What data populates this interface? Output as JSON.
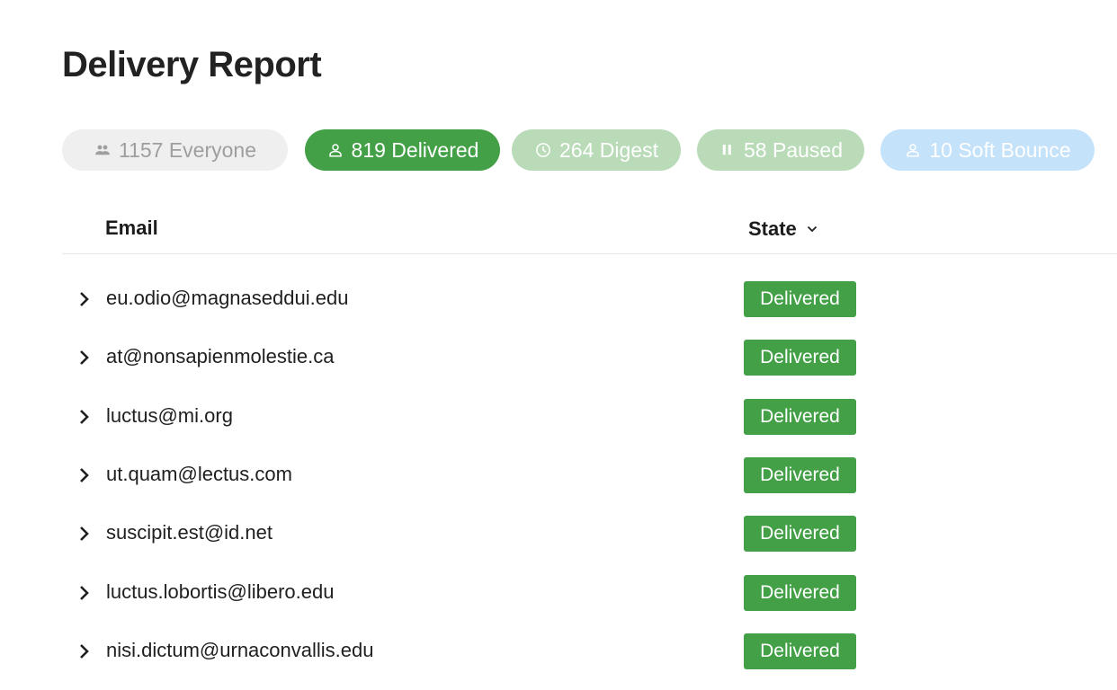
{
  "page": {
    "title": "Delivery Report"
  },
  "filters": [
    {
      "icon": "people-icon",
      "label": "1157 Everyone",
      "count": 1157,
      "name": "Everyone",
      "active": false
    },
    {
      "icon": "person-icon",
      "label": "819 Delivered",
      "count": 819,
      "name": "Delivered",
      "active": true
    },
    {
      "icon": "clock-icon",
      "label": "264 Digest",
      "count": 264,
      "name": "Digest",
      "active": false
    },
    {
      "icon": "pause-icon",
      "label": "58 Paused",
      "count": 58,
      "name": "Paused",
      "active": false
    },
    {
      "icon": "person-icon",
      "label": "10 Soft Bounce",
      "count": 10,
      "name": "Soft Bounce",
      "active": false
    }
  ],
  "table": {
    "columns": {
      "email": "Email",
      "state": "State"
    },
    "rows": [
      {
        "email": "eu.odio@magnaseddui.edu",
        "state": "Delivered"
      },
      {
        "email": "at@nonsapienmolestie.ca",
        "state": "Delivered"
      },
      {
        "email": "luctus@mi.org",
        "state": "Delivered"
      },
      {
        "email": "ut.quam@lectus.com",
        "state": "Delivered"
      },
      {
        "email": "suscipit.est@id.net",
        "state": "Delivered"
      },
      {
        "email": "luctus.lobortis@libero.edu",
        "state": "Delivered"
      },
      {
        "email": "nisi.dictum@urnaconvallis.edu",
        "state": "Delivered"
      }
    ]
  },
  "colors": {
    "delivered": "#43a047",
    "digest_paused": "#b9dbb8",
    "soft_bounce": "#c5e2fb",
    "everyone": "#efefef"
  }
}
